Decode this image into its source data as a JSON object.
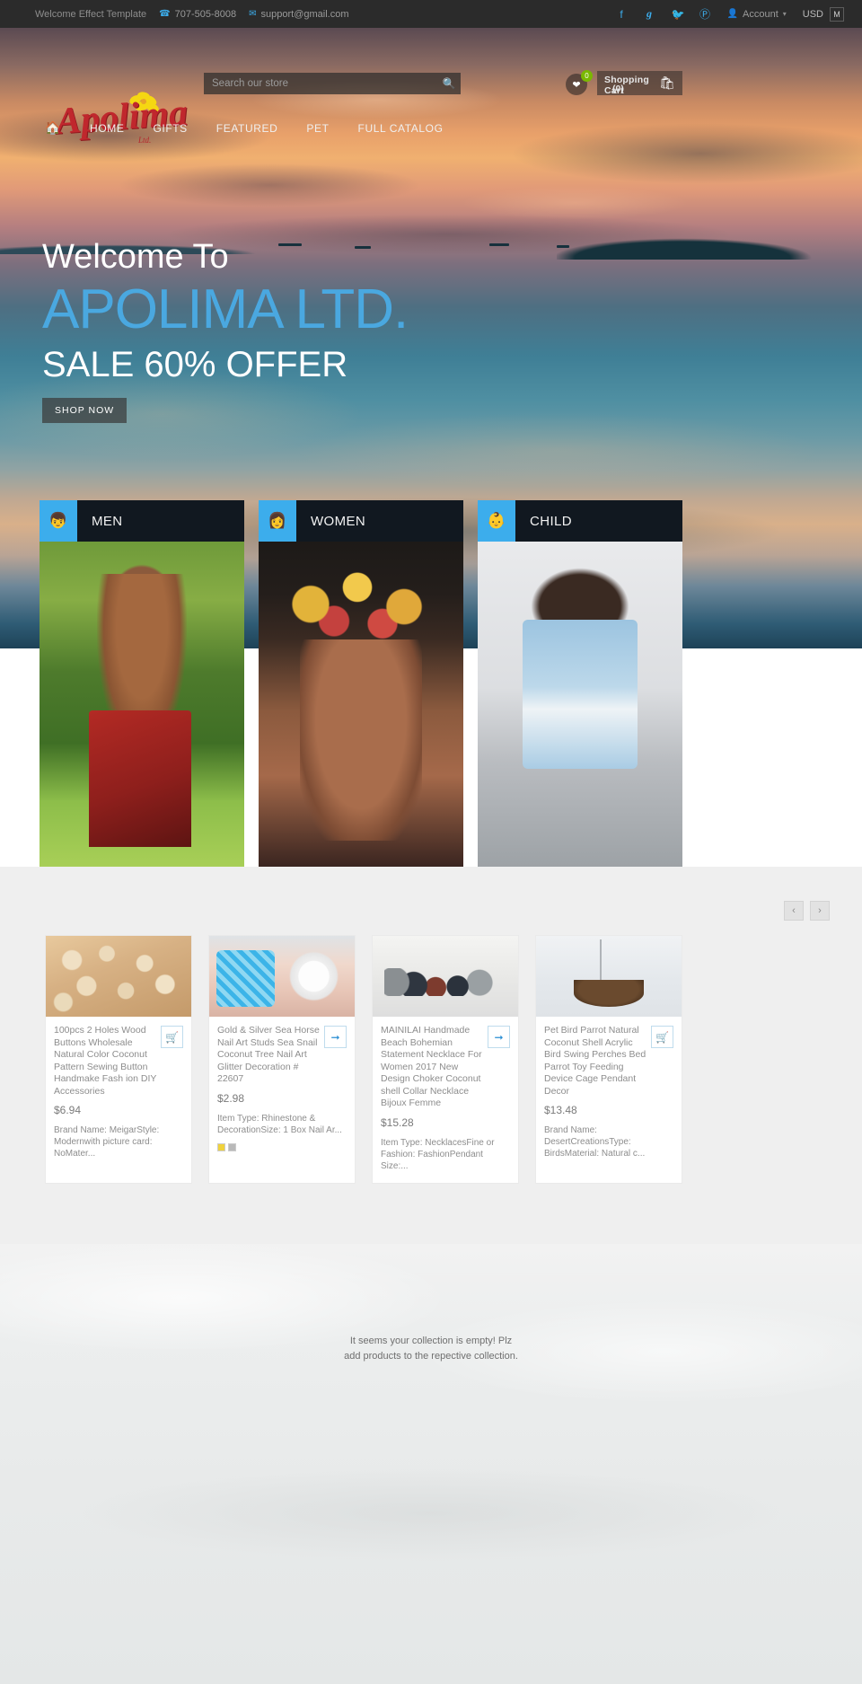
{
  "topbar": {
    "welcome_text": "Welcome Effect Template",
    "phone": "707-505-8008",
    "email": "support@gmail.com",
    "phone_icon": "phone-icon",
    "email_icon": "envelope-icon",
    "social": [
      {
        "name": "facebook-icon",
        "glyph": "f"
      },
      {
        "name": "google-plus-icon",
        "glyph": "g"
      },
      {
        "name": "twitter-icon",
        "glyph": "ᵥ"
      },
      {
        "name": "pinterest-icon",
        "glyph": "℗"
      }
    ],
    "account_label": "Account",
    "currency_label": "USD",
    "currency_flag": "M"
  },
  "header": {
    "search": {
      "placeholder": "Search our store",
      "value": ""
    },
    "wishlist_count": "0",
    "cart_label": "Shopping Cart",
    "cart_count": "(0)",
    "logo_text": "Apolima",
    "logo_suffix": "Ltd.",
    "nav": [
      {
        "label": "HOME"
      },
      {
        "label": "GIFTS"
      },
      {
        "label": "FEATURED"
      },
      {
        "label": "PET"
      },
      {
        "label": "FULL  CATALOG"
      }
    ]
  },
  "hero": {
    "line1": "Welcome To",
    "line2": "APOLIMA LTD.",
    "line3": "SALE 60% OFFER",
    "cta": "SHOP NOW",
    "brand_color": "#4aa8e0"
  },
  "categories": [
    {
      "label": "MEN",
      "icon": "male-figure-icon"
    },
    {
      "label": "WOMEN",
      "icon": "female-figure-icon"
    },
    {
      "label": "CHILD",
      "icon": "child-figure-icon"
    }
  ],
  "carousel": {
    "prev_label": "‹",
    "next_label": "›"
  },
  "products": [
    {
      "title": "100pcs 2 Holes Wood Buttons Wholesale Natural Color Coconut Pattern Sewing Button Handmake Fash ion DIY Accessories",
      "price": "$6.94",
      "desc": "Brand Name: MeigarStyle: Modernwith picture card: NoMater...",
      "button_icon": "cart-icon",
      "swatches": []
    },
    {
      "title": "Gold & Silver Sea Horse Nail Art Studs Sea Snail Coconut Tree Nail Art Glitter Decoration # 22607",
      "price": "$2.98",
      "desc": "Item Type: Rhinestone & DecorationSize: 1 Box Nail Ar...",
      "button_icon": "arrow-right-icon",
      "swatches": [
        "#f0d23c",
        "#b9b9b9"
      ]
    },
    {
      "title": "MAINILAI Handmade Beach Bohemian Statement Necklace For Women 2017 New Design Choker Coconut shell Collar Necklace Bijoux Femme",
      "price": "$15.28",
      "desc": "Item Type: NecklacesFine or Fashion: FashionPendant Size:...",
      "button_icon": "arrow-right-icon",
      "swatches": []
    },
    {
      "title": "Pet Bird Parrot Natural Coconut Shell Acrylic Bird Swing Perches Bed Parrot Toy Feeding Device Cage Pendant Decor",
      "price": "$13.48",
      "desc": "Brand Name: DesertCreationsType: BirdsMaterial: Natural c...",
      "button_icon": "cart-icon",
      "swatches": []
    }
  ],
  "empty_collection": {
    "line1": "It seems your collection is empty! Plz",
    "line2": "add products to the repective collection."
  }
}
